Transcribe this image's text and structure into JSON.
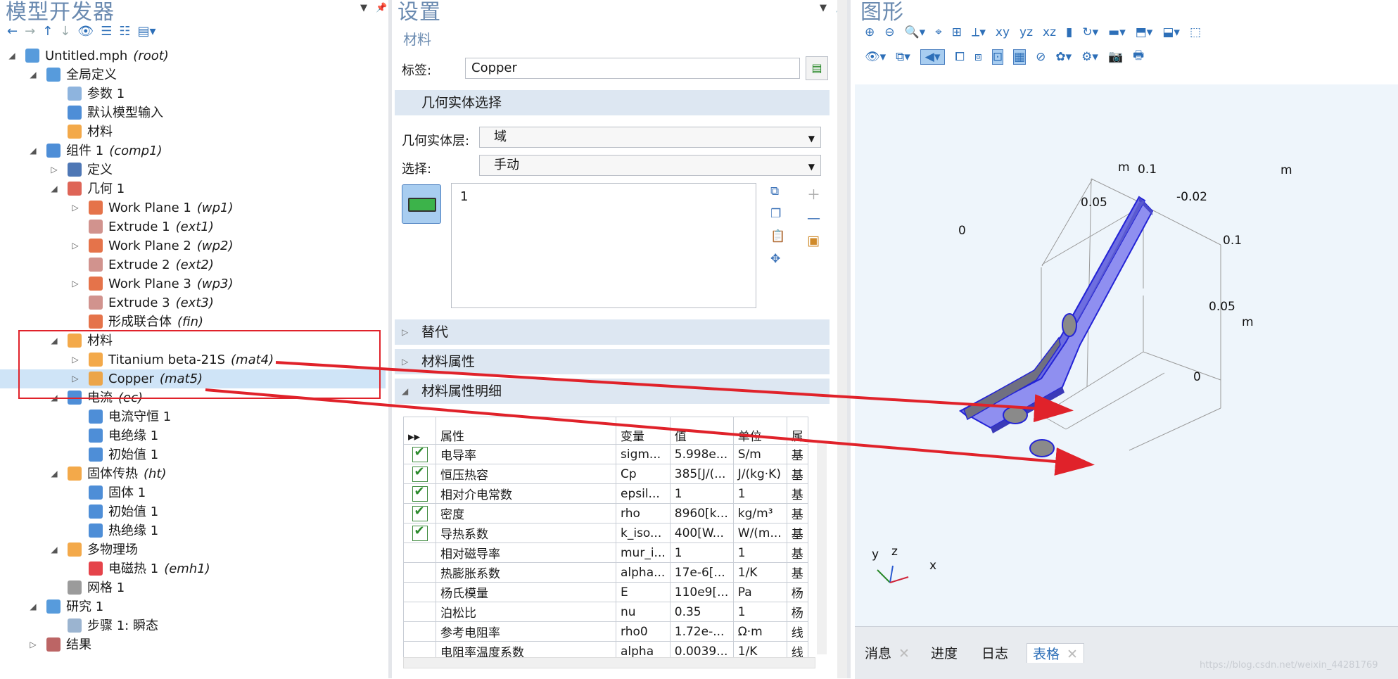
{
  "left": {
    "title": "模型开发器",
    "tree": [
      {
        "label": "Untitled.mph",
        "tag": "(root)",
        "depth": 0,
        "expand": "◢",
        "icon": "model-icon",
        "color": "#3a8ad6"
      },
      {
        "label": "全局定义",
        "tag": "",
        "depth": 1,
        "expand": "◢",
        "icon": "globe-icon",
        "color": "#3a8ad6"
      },
      {
        "label": "参数 1",
        "tag": "",
        "depth": 2,
        "expand": "",
        "icon": "parameter-icon",
        "color": "#7aa7d8"
      },
      {
        "label": "默认模型输入",
        "tag": "",
        "depth": 2,
        "expand": "",
        "icon": "model-input-icon",
        "color": "#2f7ad0"
      },
      {
        "label": "材料",
        "tag": "",
        "depth": 2,
        "expand": "",
        "icon": "materials-icon",
        "color": "#f19a2a"
      },
      {
        "label": "组件 1",
        "tag": "(comp1)",
        "depth": 1,
        "expand": "◢",
        "icon": "component-icon",
        "color": "#2f7ad0"
      },
      {
        "label": "定义",
        "tag": "",
        "depth": 2,
        "expand": "▷",
        "icon": "definitions-icon",
        "color": "#2f5fa8"
      },
      {
        "label": "几何 1",
        "tag": "",
        "depth": 2,
        "expand": "◢",
        "icon": "geometry-icon",
        "color": "#d84a3a"
      },
      {
        "label": "Work Plane 1",
        "tag": "(wp1)",
        "depth": 3,
        "expand": "▷",
        "icon": "work-plane-icon",
        "color": "#e05a2a"
      },
      {
        "label": "Extrude 1",
        "tag": "(ext1)",
        "depth": 3,
        "expand": "",
        "icon": "extrude-icon",
        "color": "#c9807a"
      },
      {
        "label": "Work Plane 2",
        "tag": "(wp2)",
        "depth": 3,
        "expand": "▷",
        "icon": "work-plane-icon",
        "color": "#e05a2a"
      },
      {
        "label": "Extrude 2",
        "tag": "(ext2)",
        "depth": 3,
        "expand": "",
        "icon": "extrude-icon",
        "color": "#c9807a"
      },
      {
        "label": "Work Plane 3",
        "tag": "(wp3)",
        "depth": 3,
        "expand": "▷",
        "icon": "work-plane-icon",
        "color": "#e05a2a"
      },
      {
        "label": "Extrude 3",
        "tag": "(ext3)",
        "depth": 3,
        "expand": "",
        "icon": "extrude-icon",
        "color": "#c9807a"
      },
      {
        "label": "形成联合体",
        "tag": "(fin)",
        "depth": 3,
        "expand": "",
        "icon": "form-union-icon",
        "color": "#e05a2a"
      },
      {
        "label": "材料",
        "tag": "",
        "depth": 2,
        "expand": "◢",
        "icon": "materials-icon",
        "color": "#f19a2a"
      },
      {
        "label": "Titanium beta-21S",
        "tag": "(mat4)",
        "depth": 3,
        "expand": "▷",
        "icon": "material-icon",
        "color": "#f19a2a"
      },
      {
        "label": "Copper",
        "tag": "(mat5)",
        "depth": 3,
        "expand": "▷",
        "icon": "material-icon",
        "color": "#f19a2a",
        "selected": true
      },
      {
        "label": "电流",
        "tag": "(ec)",
        "depth": 2,
        "expand": "◢",
        "icon": "electric-currents-icon",
        "color": "#2f7ad0"
      },
      {
        "label": "电流守恒 1",
        "tag": "",
        "depth": 3,
        "expand": "",
        "icon": "physics-node-icon",
        "color": "#2f7ad0"
      },
      {
        "label": "电绝缘 1",
        "tag": "",
        "depth": 3,
        "expand": "",
        "icon": "physics-node-icon",
        "color": "#2f7ad0"
      },
      {
        "label": "初始值 1",
        "tag": "",
        "depth": 3,
        "expand": "",
        "icon": "physics-node-icon",
        "color": "#2f7ad0"
      },
      {
        "label": "固体传热",
        "tag": "(ht)",
        "depth": 2,
        "expand": "◢",
        "icon": "heat-transfer-icon",
        "color": "#f19a2a"
      },
      {
        "label": "固体 1",
        "tag": "",
        "depth": 3,
        "expand": "",
        "icon": "physics-node-icon",
        "color": "#2f7ad0"
      },
      {
        "label": "初始值 1",
        "tag": "",
        "depth": 3,
        "expand": "",
        "icon": "physics-node-icon",
        "color": "#2f7ad0"
      },
      {
        "label": "热绝缘 1",
        "tag": "",
        "depth": 3,
        "expand": "",
        "icon": "physics-node-icon",
        "color": "#2f7ad0"
      },
      {
        "label": "多物理场",
        "tag": "",
        "depth": 2,
        "expand": "◢",
        "icon": "multiphysics-icon",
        "color": "#f19a2a"
      },
      {
        "label": "电磁热 1",
        "tag": "(emh1)",
        "depth": 3,
        "expand": "",
        "icon": "electromagnetic-heating-icon",
        "color": "#e0222a"
      },
      {
        "label": "网格 1",
        "tag": "",
        "depth": 2,
        "expand": "",
        "icon": "mesh-icon",
        "color": "#8a8a8a"
      },
      {
        "label": "研究 1",
        "tag": "",
        "depth": 1,
        "expand": "◢",
        "icon": "study-icon",
        "color": "#3a8ad6"
      },
      {
        "label": "步骤 1: 瞬态",
        "tag": "",
        "depth": 2,
        "expand": "",
        "icon": "time-step-icon",
        "color": "#8aa7c8"
      },
      {
        "label": "结果",
        "tag": "",
        "depth": 1,
        "expand": "▷",
        "icon": "results-icon",
        "color": "#b04a4a"
      }
    ]
  },
  "settings": {
    "title": "设置",
    "subtitle": "材料",
    "label_caption": "标签:",
    "label_value": "Copper",
    "geom_section": "几何实体选择",
    "level_caption": "几何实体层:",
    "level_value": "域",
    "select_caption": "选择:",
    "select_value": "手动",
    "selection_list": "1",
    "sec_override": "替代",
    "sec_props": "材料属性",
    "sec_contents": "材料属性明细",
    "table_headers": [
      "属性",
      "变量",
      "值",
      "单位",
      "属"
    ],
    "table_rows": [
      {
        "checked": true,
        "prop": "电导率",
        "var": "sigm...",
        "val": "5.998e...",
        "unit": "S/m",
        "grp": "基"
      },
      {
        "checked": true,
        "prop": "恒压热容",
        "var": "Cp",
        "val": "385[J/(...",
        "unit": "J/(kg·K)",
        "grp": "基"
      },
      {
        "checked": true,
        "prop": "相对介电常数",
        "var": "epsil...",
        "val": "1",
        "unit": "1",
        "grp": "基"
      },
      {
        "checked": true,
        "prop": "密度",
        "var": "rho",
        "val": "8960[k...",
        "unit": "kg/m³",
        "grp": "基"
      },
      {
        "checked": true,
        "prop": "导热系数",
        "var": "k_iso...",
        "val": "400[W...",
        "unit": "W/(m...",
        "grp": "基"
      },
      {
        "checked": false,
        "prop": "相对磁导率",
        "var": "mur_i...",
        "val": "1",
        "unit": "1",
        "grp": "基"
      },
      {
        "checked": false,
        "prop": "热膨胀系数",
        "var": "alpha...",
        "val": "17e-6[...",
        "unit": "1/K",
        "grp": "基"
      },
      {
        "checked": false,
        "prop": "杨氏模量",
        "var": "E",
        "val": "110e9[...",
        "unit": "Pa",
        "grp": "杨"
      },
      {
        "checked": false,
        "prop": "泊松比",
        "var": "nu",
        "val": "0.35",
        "unit": "1",
        "grp": "杨"
      },
      {
        "checked": false,
        "prop": "参考电阻率",
        "var": "rho0",
        "val": "1.72e-...",
        "unit": "Ω·m",
        "grp": "线"
      },
      {
        "checked": false,
        "prop": "电阻率温度系数",
        "var": "alpha",
        "val": "0.0039...",
        "unit": "1/K",
        "grp": "线"
      }
    ]
  },
  "graphics": {
    "title": "图形",
    "axis_labels": [
      "m",
      "0.1",
      "m",
      "0.05",
      "-0.02",
      "0",
      "0.1",
      "0.05",
      "m",
      "0"
    ],
    "triad": {
      "x": "x",
      "y": "y",
      "z": "z"
    },
    "tabs": [
      "消息",
      "进度",
      "日志",
      "表格"
    ],
    "active_tab": "表格",
    "watermark": "https://blog.csdn.net/weixin_44281769"
  },
  "colors": {
    "accent": "#2d6fb8",
    "selection": "#cfe4f7",
    "highlight": "#e0222a",
    "part": "#8f8ff0",
    "edge": "#2424d6"
  }
}
